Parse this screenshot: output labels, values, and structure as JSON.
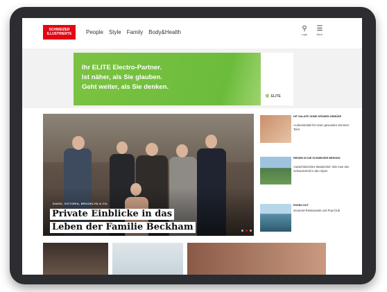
{
  "site": {
    "logo_text": "SCHWEIZER ILLUSTRIERTE",
    "nav": [
      "People",
      "Style",
      "Family",
      "Body&Health"
    ],
    "login_label": "Login",
    "menu_label": "Menu"
  },
  "ad": {
    "line1": "Ihr ELITE Electro-Partner.",
    "line2": "Ist näher, als Sie glauben.",
    "line3": "Geht weiter, als Sie denken.",
    "brand": "ELITE"
  },
  "hero": {
    "kicker": "DAVID, VICTORIA, BROOKLYN & CO.",
    "headline_line1": "Private Einblicke in das",
    "headline_line2": "Leben der Familie Beckham"
  },
  "side": [
    {
      "kicker": "HIT SALATE OHNE GRÜNEN GEMÜSE",
      "text": "«Lebensmittel für einen gesunden Sommer-Teint"
    },
    {
      "kicker": "REISEN IN DIE SCHWEIZER BERGEN",
      "text": "Aussichtsreiches Wanderziel: Wie man den Schweizerhof in den Alpen"
    },
    {
      "kicker": "ESSEN GUT",
      "text": "Gourmet-Restaurants und Pop-Club"
    }
  ],
  "colors": {
    "brand_red": "#e30613",
    "ad_green": "#6cbc3c"
  }
}
